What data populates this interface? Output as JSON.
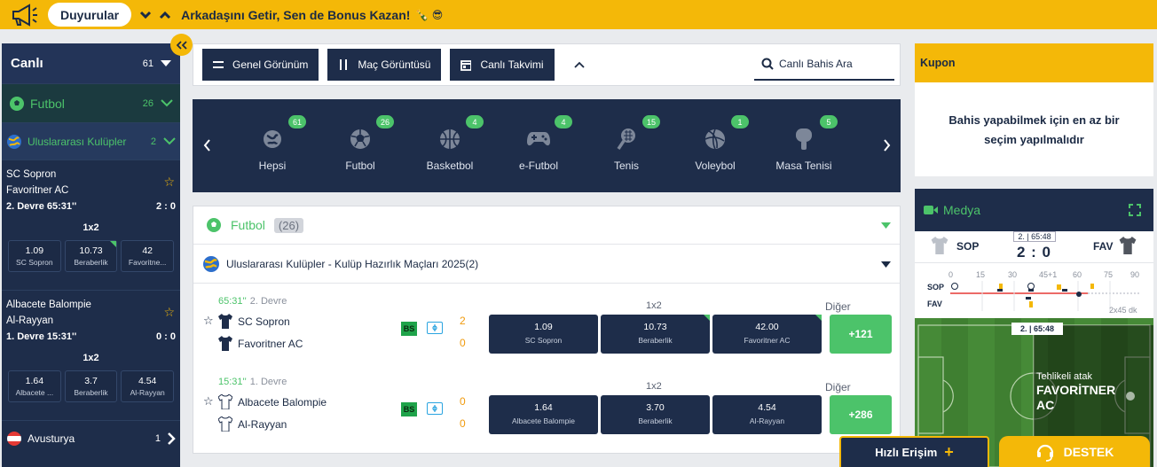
{
  "topbar": {
    "announcements": "Duyurular",
    "promo": "Arkadaşını Getir, Sen de Bonus Kazan!",
    "promo_emoji": "🍾 😎"
  },
  "sidebar": {
    "live_title": "Canlı",
    "live_count": "61",
    "sport": {
      "name": "Futbol",
      "count": "26"
    },
    "league": {
      "name": "Uluslararası Kulüpler",
      "count": "2"
    },
    "matches": [
      {
        "home": "SC Sopron",
        "away": "Favoritner AC",
        "time": "2. Devre 65:31''",
        "score": "2 : 0",
        "market": "1x2",
        "odds": [
          {
            "v": "1.09",
            "l": "SC Sopron"
          },
          {
            "v": "10.73",
            "l": "Beraberlik"
          },
          {
            "v": "42",
            "l": "Favoritne..."
          }
        ]
      },
      {
        "home": "Albacete Balompie",
        "away": "Al-Rayyan",
        "time": "1. Devre 15:31''",
        "score": "0 : 0",
        "market": "1x2",
        "odds": [
          {
            "v": "1.64",
            "l": "Albacete ..."
          },
          {
            "v": "3.7",
            "l": "Beraberlik"
          },
          {
            "v": "4.54",
            "l": "Al-Rayyan"
          }
        ]
      }
    ],
    "country": {
      "name": "Avusturya",
      "count": "1"
    }
  },
  "toolbar": {
    "overview": "Genel Görünüm",
    "match_view": "Maç Görüntüsü",
    "live_calendar": "Canlı Takvimi",
    "search_placeholder": "Canlı Bahis Ara"
  },
  "sports": [
    {
      "name": "Hepsi",
      "count": "61"
    },
    {
      "name": "Futbol",
      "count": "26"
    },
    {
      "name": "Basketbol",
      "count": "4"
    },
    {
      "name": "e-Futbol",
      "count": "4"
    },
    {
      "name": "Tenis",
      "count": "15"
    },
    {
      "name": "Voleybol",
      "count": "1"
    },
    {
      "name": "Masa Tenisi",
      "count": "5"
    }
  ],
  "events": {
    "sport": "Futbol",
    "count": "(26)",
    "league": "Uluslararası Kulüpler - Kulüp Hazırlık Maçları 2025(2)",
    "matches": [
      {
        "time": "65:31''",
        "period": "2. Devre",
        "home": "SC Sopron",
        "away": "Favoritner AC",
        "bs": "BS",
        "hs": "2",
        "as": "0",
        "market": "1x2",
        "odds": [
          {
            "v": "1.09",
            "l": "SC Sopron"
          },
          {
            "v": "10.73",
            "l": "Beraberlik"
          },
          {
            "v": "42.00",
            "l": "Favoritner AC"
          }
        ],
        "other": "Diğer",
        "more": "+121"
      },
      {
        "time": "15:31''",
        "period": "1. Devre",
        "home": "Albacete Balompie",
        "away": "Al-Rayyan",
        "bs": "BS",
        "hs": "0",
        "as": "0",
        "market": "1x2",
        "odds": [
          {
            "v": "1.64",
            "l": "Albacete Balompie"
          },
          {
            "v": "3.70",
            "l": "Beraberlik"
          },
          {
            "v": "4.54",
            "l": "Al-Rayyan"
          }
        ],
        "other": "Diğer",
        "more": "+286"
      }
    ]
  },
  "kupon": {
    "title": "Kupon",
    "message": "Bahis yapabilmek için en az bir seçim yapılmalıdır"
  },
  "media": {
    "title": "Medya",
    "home": "SOP",
    "away": "FAV",
    "clock": "2. | 65:48",
    "score": "2 : 0",
    "ticks": [
      "0",
      "15",
      "30",
      "45+1",
      "60",
      "75",
      "90"
    ],
    "row1": "SOP",
    "row2": "FAV",
    "dk": "2x45 dk",
    "pitch_clock": "2. | 65:48",
    "attack_label": "Tehlikeli atak",
    "attack_team": "FAVORİTNER AC"
  },
  "footer": {
    "quick": "Hızlı Erişim",
    "support": "DESTEK"
  }
}
